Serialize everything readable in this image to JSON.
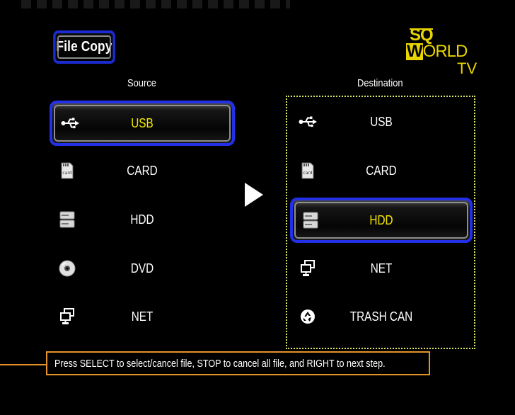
{
  "title": "File Copy",
  "logo": {
    "line1": "SQ",
    "line2_highlight": "W",
    "line2_rest": "ORLD",
    "line3": "TV"
  },
  "columns": {
    "source": "Source",
    "destination": "Destination"
  },
  "source_items": [
    {
      "label": "USB",
      "icon": "usb-icon",
      "selected": true
    },
    {
      "label": "CARD",
      "icon": "card-icon",
      "selected": false
    },
    {
      "label": "HDD",
      "icon": "hdd-icon",
      "selected": false
    },
    {
      "label": "DVD",
      "icon": "dvd-icon",
      "selected": false
    },
    {
      "label": "NET",
      "icon": "network-icon",
      "selected": false
    }
  ],
  "destination_items": [
    {
      "label": "USB",
      "icon": "usb-icon",
      "selected": false
    },
    {
      "label": "CARD",
      "icon": "card-icon",
      "selected": false
    },
    {
      "label": "HDD",
      "icon": "hdd-icon",
      "selected": true
    },
    {
      "label": "NET",
      "icon": "network-icon",
      "selected": false
    },
    {
      "label": "TRASH CAN",
      "icon": "recycle-icon",
      "selected": false
    }
  ],
  "card_icon_text": "card",
  "hint": "Press SELECT to select/cancel file, STOP to cancel all file, and RIGHT to next step.",
  "colors": {
    "background": "#000000",
    "selection_border": "#2430e8",
    "selected_text": "#f2e800",
    "destination_box": "#dbe36a",
    "hint_border": "#e6922b"
  }
}
